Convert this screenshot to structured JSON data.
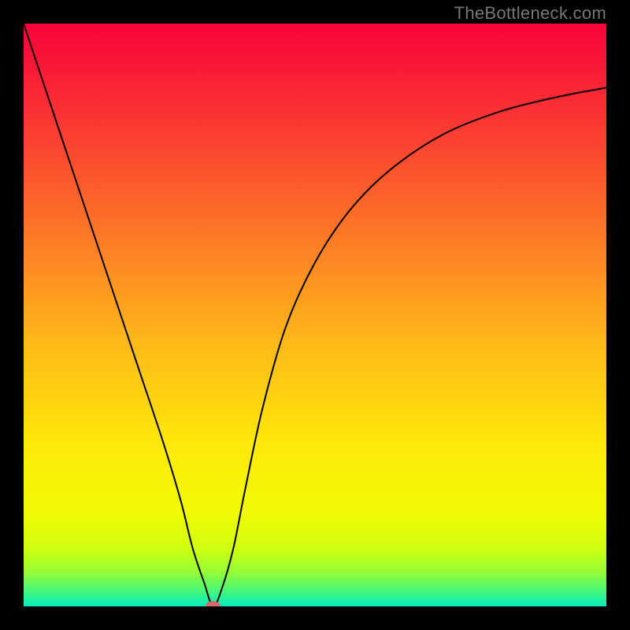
{
  "watermark": "TheBottleneck.com",
  "chart_data": {
    "type": "line",
    "title": "",
    "xlabel": "",
    "ylabel": "",
    "xlim": [
      0,
      100
    ],
    "ylim": [
      0,
      100
    ],
    "grid": false,
    "legend": false,
    "background_gradient": {
      "stops": [
        {
          "pos": 0.0,
          "color": "#f8023a"
        },
        {
          "pos": 0.2,
          "color": "#fb4131"
        },
        {
          "pos": 0.4,
          "color": "#fd8524"
        },
        {
          "pos": 0.55,
          "color": "#feb918"
        },
        {
          "pos": 0.72,
          "color": "#fee80a"
        },
        {
          "pos": 0.84,
          "color": "#f1fb05"
        },
        {
          "pos": 0.9,
          "color": "#d0fe0f"
        },
        {
          "pos": 0.94,
          "color": "#98fd34"
        },
        {
          "pos": 0.97,
          "color": "#50f770"
        },
        {
          "pos": 1.0,
          "color": "#05eec0"
        }
      ]
    },
    "series": [
      {
        "name": "bottleneck-curve",
        "color": "#000000",
        "x": [
          0,
          4,
          8,
          12,
          16,
          20,
          24,
          27,
          29,
          31,
          32.5,
          34,
          36,
          38,
          41,
          45,
          50,
          56,
          63,
          72,
          82,
          92,
          100
        ],
        "y": [
          100,
          88,
          76,
          64,
          52,
          40,
          28,
          18,
          10,
          4,
          0,
          3,
          10,
          20,
          34,
          48,
          59,
          68,
          75,
          81,
          85,
          87.5,
          89
        ]
      }
    ],
    "marker": {
      "name": "min-point",
      "x": 32.5,
      "y": 0,
      "rx": 1.3,
      "ry": 0.9,
      "fill": "#d66a6a"
    }
  }
}
